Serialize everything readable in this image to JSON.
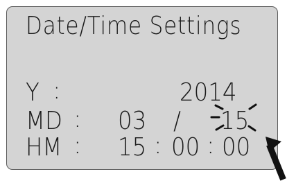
{
  "screen": {
    "title": "Date/Time Settings",
    "rows": {
      "year": {
        "label": "Y",
        "separator": ":",
        "value": "2014"
      },
      "month_day": {
        "label": "MD",
        "separator": ":",
        "month": "03",
        "slash": "/",
        "day": "15"
      },
      "hour_minute": {
        "label": "HM",
        "separator": ":",
        "hour": "15",
        "colon1": ":",
        "minute": "00",
        "colon2": ":",
        "second": "00"
      }
    },
    "blinking_field": "day",
    "cursor_pointer": "arrow-pointer-to-seconds"
  },
  "colors": {
    "lcd_background": "#d4d4d4",
    "lcd_text": "#1a1a1a",
    "frame": "#5a5a5a",
    "arrow": "#111111"
  }
}
